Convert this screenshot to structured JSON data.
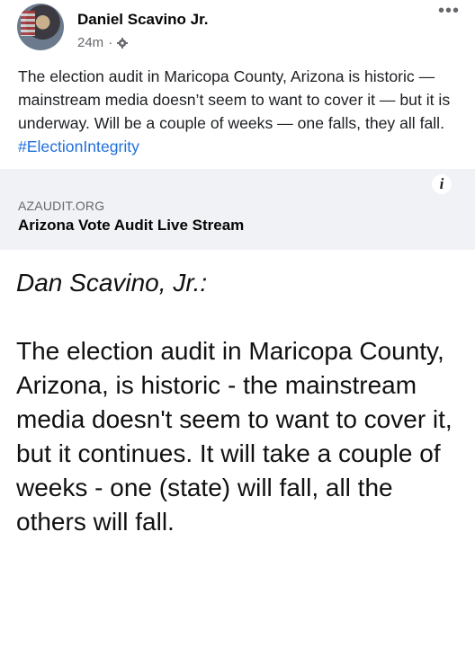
{
  "post": {
    "author": "Daniel Scavino Jr.",
    "timestamp": "24m",
    "separator": "·",
    "privacy_icon": "gear-icon",
    "more_icon": "ellipsis-icon",
    "more_label": "•••",
    "text_main": "The election audit in Maricopa County, Arizona is historic — mainstream media doesn’t seem to want to cover it — but it is underway. Will be a couple of weeks — one falls, they all fall.",
    "hashtag": "#ElectionIntegrity"
  },
  "link_card": {
    "info_label": "i",
    "domain": "AZAUDIT.ORG",
    "title": "Arizona Vote Audit Live Stream"
  },
  "transcript": {
    "speaker": "Dan Scavino, Jr.:",
    "body": "The election audit in Maricopa County, Arizona, is historic - the mainstream media doesn't seem to want to cover it, but it continues. It will take a couple of weeks - one (state) will fall, all the others will fall."
  },
  "colors": {
    "link_blue": "#216fdb",
    "card_bg": "#f0f2f5",
    "meta_gray": "#65676b"
  }
}
